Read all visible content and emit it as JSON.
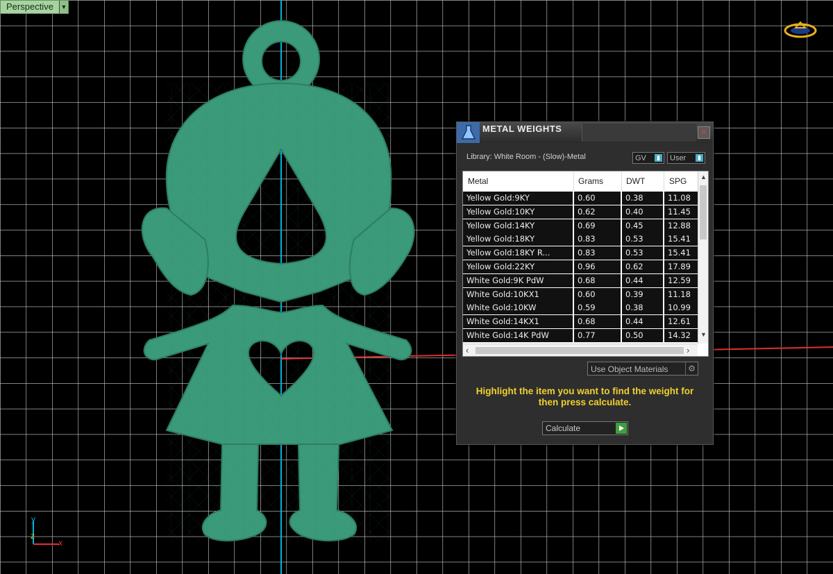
{
  "viewport": {
    "label": "Perspective",
    "axis_labels": {
      "y": "y",
      "z": "z",
      "x": "x"
    }
  },
  "dialog": {
    "title": "METAL WEIGHTS",
    "library_label": "Library: White Room - (Slow)-Metal",
    "gv_label": "GV",
    "user_label": "User",
    "columns": [
      "Metal",
      "Grams",
      "DWT",
      "SPG"
    ],
    "rows": [
      {
        "metal": "Yellow Gold:9KY",
        "grams": "0.60",
        "dwt": "0.38",
        "spg": "11.08"
      },
      {
        "metal": "Yellow Gold:10KY",
        "grams": "0.62",
        "dwt": "0.40",
        "spg": "11.45"
      },
      {
        "metal": "Yellow Gold:14KY",
        "grams": "0.69",
        "dwt": "0.45",
        "spg": "12.88"
      },
      {
        "metal": "Yellow Gold:18KY",
        "grams": "0.83",
        "dwt": "0.53",
        "spg": "15.41"
      },
      {
        "metal": "Yellow Gold:18KY R...",
        "grams": "0.83",
        "dwt": "0.53",
        "spg": "15.41"
      },
      {
        "metal": "Yellow Gold:22KY",
        "grams": "0.96",
        "dwt": "0.62",
        "spg": "17.89"
      },
      {
        "metal": "White Gold:9K PdW",
        "grams": "0.68",
        "dwt": "0.44",
        "spg": "12.59"
      },
      {
        "metal": "White Gold:10KX1",
        "grams": "0.60",
        "dwt": "0.39",
        "spg": "11.18"
      },
      {
        "metal": "White Gold:10KW",
        "grams": "0.59",
        "dwt": "0.38",
        "spg": "10.99"
      },
      {
        "metal": "White Gold:14KX1",
        "grams": "0.68",
        "dwt": "0.44",
        "spg": "12.61"
      },
      {
        "metal": "White Gold:14K PdW",
        "grams": "0.77",
        "dwt": "0.50",
        "spg": "14.32"
      }
    ],
    "material_select": "Use Object Materials",
    "message": "Highlight the item you want to find the weight for then press calculate.",
    "calculate_label": "Calculate"
  },
  "colors": {
    "background": "#000000",
    "grid": "#d8d8d8",
    "model_fill": "#3a9a7a",
    "y_axis": "#00b4d8",
    "x_axis": "#e03030",
    "message": "#f0d030"
  }
}
